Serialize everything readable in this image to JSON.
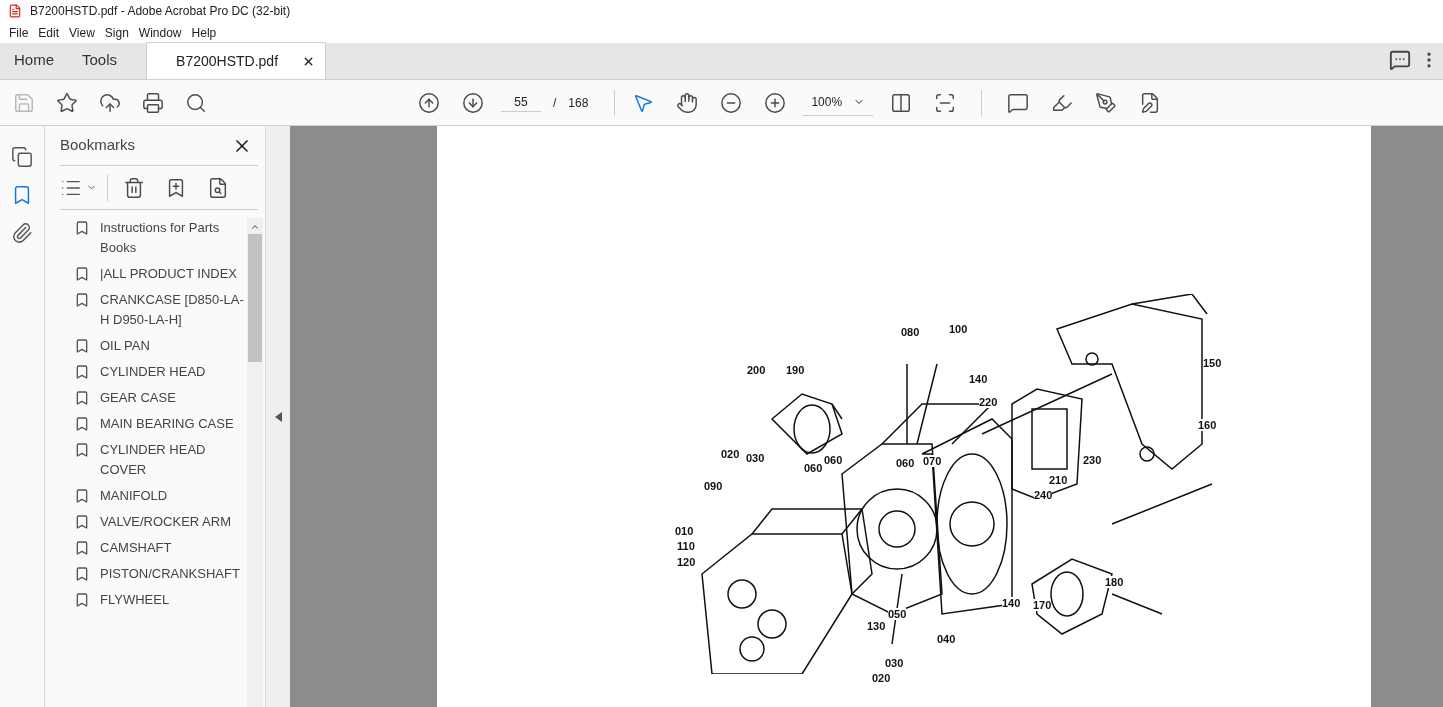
{
  "window": {
    "title": "B7200HSTD.pdf - Adobe Acrobat Pro DC (32-bit)"
  },
  "menu": [
    "File",
    "Edit",
    "View",
    "Sign",
    "Window",
    "Help"
  ],
  "tabs": [
    {
      "label": "Home",
      "selected": false
    },
    {
      "label": "Tools",
      "selected": false
    },
    {
      "label": "B7200HSTD.pdf",
      "selected": true
    }
  ],
  "toolbar": {
    "page_current": "55",
    "page_separator": "/",
    "page_total": "168",
    "zoom": "100%"
  },
  "rail": [
    {
      "kind": "pages",
      "selected": false
    },
    {
      "kind": "bookmarks",
      "selected": true
    },
    {
      "kind": "attachments",
      "selected": false
    }
  ],
  "bookmarks": {
    "title": "Bookmarks",
    "items": [
      "Instructions for Parts Books",
      "|ALL PRODUCT INDEX",
      "CRANKCASE [D850-LA-H D950-LA-H]",
      "OIL PAN",
      "CYLINDER HEAD",
      "GEAR CASE",
      "MAIN BEARING CASE",
      "CYLINDER HEAD COVER",
      "MANIFOLD",
      "VALVE/ROCKER ARM",
      "CAMSHAFT",
      "PISTON/CRANKSHAFT",
      "FLYWHEEL"
    ]
  },
  "callouts": [
    "080",
    "100",
    "200",
    "190",
    "140",
    "220",
    "150",
    "160",
    "020",
    "030",
    "060",
    "060",
    "060",
    "070",
    "230",
    "090",
    "210",
    "240",
    "010",
    "110",
    "120",
    "180",
    "140",
    "170",
    "050",
    "130",
    "040",
    "030",
    "020"
  ]
}
